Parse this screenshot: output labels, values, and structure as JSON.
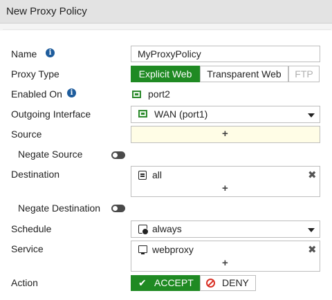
{
  "window": {
    "title": "New Proxy Policy"
  },
  "form": {
    "name": {
      "label": "Name",
      "value": "MyProxyPolicy"
    },
    "proxy_type": {
      "label": "Proxy Type",
      "options": [
        "Explicit Web",
        "Transparent Web",
        "FTP"
      ],
      "selected": "Explicit Web",
      "disabled": [
        "FTP"
      ]
    },
    "enabled_on": {
      "label": "Enabled On",
      "value": "port2"
    },
    "outgoing_interface": {
      "label": "Outgoing Interface",
      "value": "WAN (port1)"
    },
    "source": {
      "label": "Source",
      "add_symbol": "+"
    },
    "negate_source": {
      "label": "Negate Source",
      "enabled": false
    },
    "destination": {
      "label": "Destination",
      "items": [
        "all"
      ],
      "add_symbol": "+",
      "remove_symbol": "✖"
    },
    "negate_destination": {
      "label": "Negate Destination",
      "enabled": false
    },
    "schedule": {
      "label": "Schedule",
      "value": "always"
    },
    "service": {
      "label": "Service",
      "items": [
        "webproxy"
      ],
      "add_symbol": "+",
      "remove_symbol": "✖"
    },
    "action": {
      "label": "Action",
      "options": [
        "ACCEPT",
        "DENY"
      ],
      "selected": "ACCEPT",
      "accept_icon": "✔"
    }
  },
  "icons": {
    "info": "info-icon",
    "port": "port-icon",
    "address": "address-icon",
    "schedule": "schedule-icon",
    "service": "service-icon",
    "deny": "deny-circle-icon"
  },
  "colors": {
    "accent_green": "#1f8a23",
    "source_highlight": "#fffde6",
    "info_blue": "#1e5c9c",
    "deny_red": "#d93025"
  }
}
